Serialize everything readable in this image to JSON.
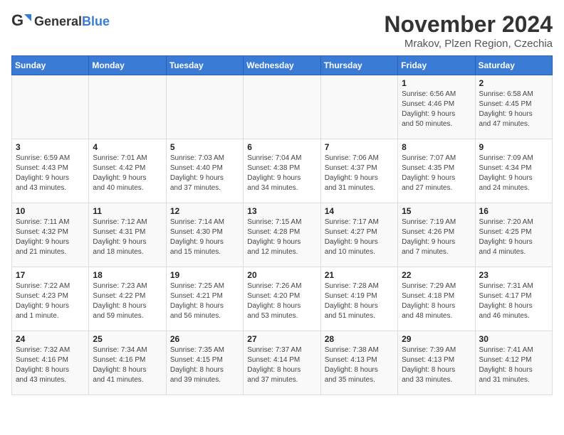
{
  "header": {
    "logo_general": "General",
    "logo_blue": "Blue",
    "main_title": "November 2024",
    "subtitle": "Mrakov, Plzen Region, Czechia"
  },
  "days_of_week": [
    "Sunday",
    "Monday",
    "Tuesday",
    "Wednesday",
    "Thursday",
    "Friday",
    "Saturday"
  ],
  "weeks": [
    [
      {
        "day": "",
        "info": ""
      },
      {
        "day": "",
        "info": ""
      },
      {
        "day": "",
        "info": ""
      },
      {
        "day": "",
        "info": ""
      },
      {
        "day": "",
        "info": ""
      },
      {
        "day": "1",
        "info": "Sunrise: 6:56 AM\nSunset: 4:46 PM\nDaylight: 9 hours\nand 50 minutes."
      },
      {
        "day": "2",
        "info": "Sunrise: 6:58 AM\nSunset: 4:45 PM\nDaylight: 9 hours\nand 47 minutes."
      }
    ],
    [
      {
        "day": "3",
        "info": "Sunrise: 6:59 AM\nSunset: 4:43 PM\nDaylight: 9 hours\nand 43 minutes."
      },
      {
        "day": "4",
        "info": "Sunrise: 7:01 AM\nSunset: 4:42 PM\nDaylight: 9 hours\nand 40 minutes."
      },
      {
        "day": "5",
        "info": "Sunrise: 7:03 AM\nSunset: 4:40 PM\nDaylight: 9 hours\nand 37 minutes."
      },
      {
        "day": "6",
        "info": "Sunrise: 7:04 AM\nSunset: 4:38 PM\nDaylight: 9 hours\nand 34 minutes."
      },
      {
        "day": "7",
        "info": "Sunrise: 7:06 AM\nSunset: 4:37 PM\nDaylight: 9 hours\nand 31 minutes."
      },
      {
        "day": "8",
        "info": "Sunrise: 7:07 AM\nSunset: 4:35 PM\nDaylight: 9 hours\nand 27 minutes."
      },
      {
        "day": "9",
        "info": "Sunrise: 7:09 AM\nSunset: 4:34 PM\nDaylight: 9 hours\nand 24 minutes."
      }
    ],
    [
      {
        "day": "10",
        "info": "Sunrise: 7:11 AM\nSunset: 4:32 PM\nDaylight: 9 hours\nand 21 minutes."
      },
      {
        "day": "11",
        "info": "Sunrise: 7:12 AM\nSunset: 4:31 PM\nDaylight: 9 hours\nand 18 minutes."
      },
      {
        "day": "12",
        "info": "Sunrise: 7:14 AM\nSunset: 4:30 PM\nDaylight: 9 hours\nand 15 minutes."
      },
      {
        "day": "13",
        "info": "Sunrise: 7:15 AM\nSunset: 4:28 PM\nDaylight: 9 hours\nand 12 minutes."
      },
      {
        "day": "14",
        "info": "Sunrise: 7:17 AM\nSunset: 4:27 PM\nDaylight: 9 hours\nand 10 minutes."
      },
      {
        "day": "15",
        "info": "Sunrise: 7:19 AM\nSunset: 4:26 PM\nDaylight: 9 hours\nand 7 minutes."
      },
      {
        "day": "16",
        "info": "Sunrise: 7:20 AM\nSunset: 4:25 PM\nDaylight: 9 hours\nand 4 minutes."
      }
    ],
    [
      {
        "day": "17",
        "info": "Sunrise: 7:22 AM\nSunset: 4:23 PM\nDaylight: 9 hours\nand 1 minute."
      },
      {
        "day": "18",
        "info": "Sunrise: 7:23 AM\nSunset: 4:22 PM\nDaylight: 8 hours\nand 59 minutes."
      },
      {
        "day": "19",
        "info": "Sunrise: 7:25 AM\nSunset: 4:21 PM\nDaylight: 8 hours\nand 56 minutes."
      },
      {
        "day": "20",
        "info": "Sunrise: 7:26 AM\nSunset: 4:20 PM\nDaylight: 8 hours\nand 53 minutes."
      },
      {
        "day": "21",
        "info": "Sunrise: 7:28 AM\nSunset: 4:19 PM\nDaylight: 8 hours\nand 51 minutes."
      },
      {
        "day": "22",
        "info": "Sunrise: 7:29 AM\nSunset: 4:18 PM\nDaylight: 8 hours\nand 48 minutes."
      },
      {
        "day": "23",
        "info": "Sunrise: 7:31 AM\nSunset: 4:17 PM\nDaylight: 8 hours\nand 46 minutes."
      }
    ],
    [
      {
        "day": "24",
        "info": "Sunrise: 7:32 AM\nSunset: 4:16 PM\nDaylight: 8 hours\nand 43 minutes."
      },
      {
        "day": "25",
        "info": "Sunrise: 7:34 AM\nSunset: 4:16 PM\nDaylight: 8 hours\nand 41 minutes."
      },
      {
        "day": "26",
        "info": "Sunrise: 7:35 AM\nSunset: 4:15 PM\nDaylight: 8 hours\nand 39 minutes."
      },
      {
        "day": "27",
        "info": "Sunrise: 7:37 AM\nSunset: 4:14 PM\nDaylight: 8 hours\nand 37 minutes."
      },
      {
        "day": "28",
        "info": "Sunrise: 7:38 AM\nSunset: 4:13 PM\nDaylight: 8 hours\nand 35 minutes."
      },
      {
        "day": "29",
        "info": "Sunrise: 7:39 AM\nSunset: 4:13 PM\nDaylight: 8 hours\nand 33 minutes."
      },
      {
        "day": "30",
        "info": "Sunrise: 7:41 AM\nSunset: 4:12 PM\nDaylight: 8 hours\nand 31 minutes."
      }
    ]
  ]
}
